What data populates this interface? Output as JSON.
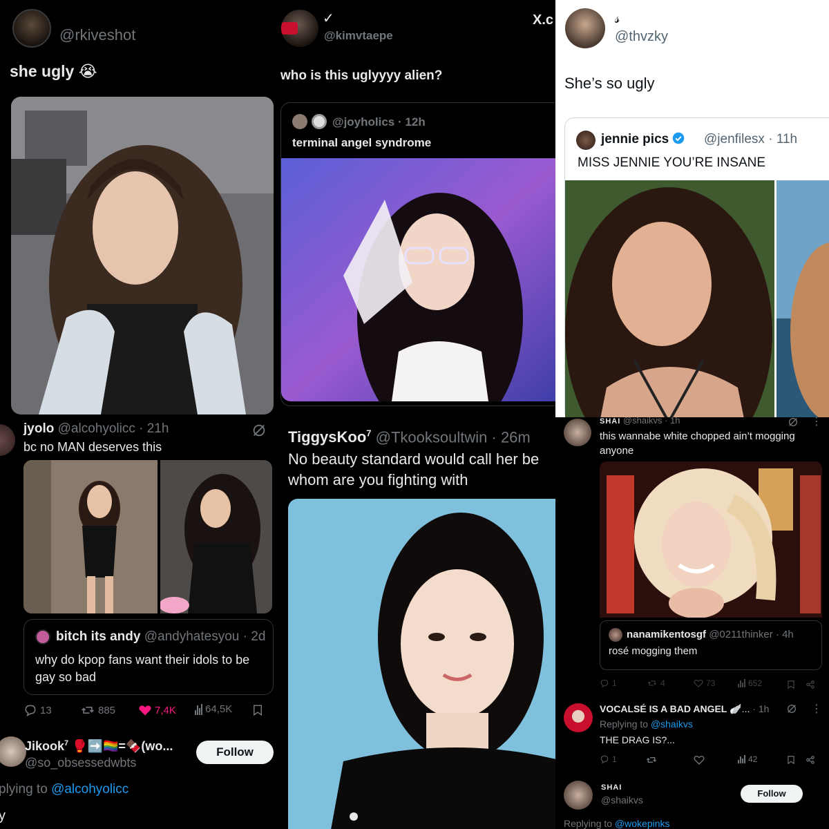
{
  "p1": {
    "handle": "@rkiveshot",
    "text": "she ugly",
    "emoji": "😭"
  },
  "p2": {
    "check": "✓",
    "handle": "@kimvtaepe",
    "corner": "X.c",
    "text": "who is this uglyyyy alien?",
    "quote": {
      "handle": "@joyholics",
      "sep": "·",
      "time": "12h",
      "text": "terminal angel syndrome"
    }
  },
  "p3": {
    "display": "𝓈",
    "handle": "@thvzky",
    "text": "She’s so ugly",
    "quote": {
      "name": "jennie pics",
      "handle": "@jenfilesx",
      "sep": "·",
      "time": "11h",
      "text": "MISS JENNIE YOU’RE INSANE"
    }
  },
  "p4": {
    "name": "jyolo",
    "handle": "@alcohyolicc",
    "sep": "·",
    "time": "21h",
    "text": "bc no MAN deserves this",
    "quote": {
      "name": "bitch its andy",
      "handle": "@andyhatesyou",
      "sep": "·",
      "time": "2d",
      "line1": "why do kpop fans want their idols to be",
      "line2": "gay so bad"
    },
    "stats": {
      "replies": "13",
      "reposts": "885",
      "likes": "7,4K",
      "views": "64,5K"
    },
    "reply": {
      "name": "Jikook",
      "name_sup": "7",
      "name_tail": "🥊➡️🏳️‍🌈=🍫(wo...",
      "handle": "@so_obsessedwbts",
      "follow": "Follow",
      "replying_prefix": "plying to",
      "replying_handle": "@alcohyolicc",
      "text": "y"
    }
  },
  "p5": {
    "name": "TiggysKoo",
    "name_sup": "7",
    "handle": "@Tkooksoultwin",
    "sep": "·",
    "time": "26m",
    "line1": "No beauty standard would call her be",
    "line2": "whom are you fighting with"
  },
  "p6": {
    "name": "SHAI",
    "handle": "@shaikvs",
    "sep": "·",
    "time": "1h",
    "line1": "this wannabe white chopped ain’t mogging",
    "line2": "anyone",
    "quote": {
      "name": "nanamikentosgf",
      "handle": "@0211thinker",
      "sep": "·",
      "time": "4h",
      "text": "rosé mogging them"
    },
    "stats": {
      "replies": "1",
      "reposts": "4",
      "likes": "73",
      "views": "652"
    },
    "reply": {
      "name": "VOCALSÉ IS A BAD ANGEL",
      "name_tail": "🪽...",
      "sep": "·",
      "time": "1h",
      "replying_prefix": "Replying to",
      "replying_handle": "@shaikvs",
      "text": "THE DRAG IS?...",
      "stats": {
        "replies": "1",
        "views": "42"
      }
    },
    "footer": {
      "name": "SHAI",
      "handle": "@shaikvs",
      "follow": "Follow",
      "replying_prefix": "Replying to",
      "replying_handle": "@wokepinks"
    }
  },
  "colors": {
    "like_pink": "#f91880",
    "link_blue": "#1d9bf0",
    "verified_blue": "#1d9bf0"
  }
}
